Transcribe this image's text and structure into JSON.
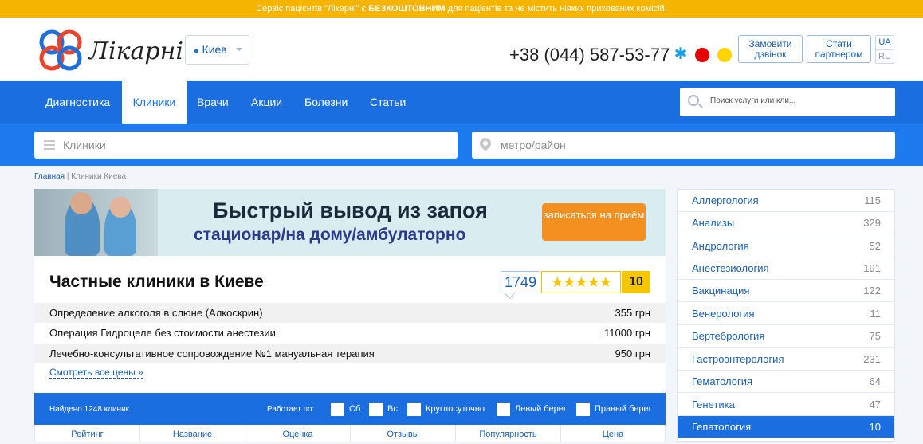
{
  "topbar": {
    "prefix": "Сервіс пацієнтів \"Лікарні\" є ",
    "bold": "БЕЗКОШТОВНИМ",
    "suffix": " для пацієнтів та не містить ніяких прихованих комісій."
  },
  "header": {
    "logo_text": "Лікарні",
    "city": "Киев",
    "phone": "+38 (044) 587-53-77",
    "operators": [
      "kyivstar-icon",
      "vodafone-icon",
      "lifecell-icon"
    ],
    "callback_button": "Замовити дзвінок",
    "partner_button": "Стати партнером",
    "lang_ua": "UA",
    "lang_ru": "RU"
  },
  "nav": {
    "items": [
      {
        "label": "Диагностика"
      },
      {
        "label": "Клиники"
      },
      {
        "label": "Врачи"
      },
      {
        "label": "Акции"
      },
      {
        "label": "Болезни"
      },
      {
        "label": "Статьи"
      }
    ],
    "search_placeholder": "Поиск услуги или кли..."
  },
  "filters": {
    "clinic_placeholder": "Клиники",
    "location_placeholder": "метро/район"
  },
  "breadcrumb": {
    "home": "Главная",
    "separator": "|",
    "current": "Клиники Киева"
  },
  "banner": {
    "title": "Быстрый вывод из запоя",
    "subtitle": "стационар/на дому/амбулаторно",
    "cta": "записаться на приём"
  },
  "main": {
    "title": "Частные клиники в Киеве",
    "reviews_count": "1749",
    "stars": "★★★★★",
    "score": "10",
    "prices": [
      {
        "name": "Определение алкоголя в слюне (Алкоскрин)",
        "price": "355 грн"
      },
      {
        "name": "Операция Гидроцеле без стоимости анестезии",
        "price": "11000 грн"
      },
      {
        "name": "Лечебно-консультативное сопровождение №1 мануальная терапия",
        "price": "950 грн"
      }
    ],
    "more_prices": "Смотреть все цены »"
  },
  "results": {
    "found": "Найдено  1248 клиник",
    "works_label": "Работает по:",
    "checks": [
      "Сб",
      "Вс",
      "Круглосуточно",
      "Левый берег",
      "Правый берег"
    ],
    "columns": [
      "Рейтинг",
      "Название",
      "Оценка",
      "Отзывы",
      "Популярность",
      "Цена"
    ]
  },
  "sidebar": {
    "items": [
      {
        "label": "Аллергология",
        "count": "115"
      },
      {
        "label": "Анализы",
        "count": "329"
      },
      {
        "label": "Андрология",
        "count": "52"
      },
      {
        "label": "Анестезиология",
        "count": "191"
      },
      {
        "label": "Вакцинация",
        "count": "122"
      },
      {
        "label": "Венерология",
        "count": "11"
      },
      {
        "label": "Вертебрология",
        "count": "75"
      },
      {
        "label": "Гастроэнтерология",
        "count": "231"
      },
      {
        "label": "Гематология",
        "count": "64"
      },
      {
        "label": "Генетика",
        "count": "47"
      },
      {
        "label": "Гепатология",
        "count": "10"
      }
    ],
    "active_index": 10
  },
  "colors": {
    "accent": "#1a6ee0",
    "topbar": "#f4b400",
    "cta": "#f39020",
    "star": "#f4c400"
  }
}
